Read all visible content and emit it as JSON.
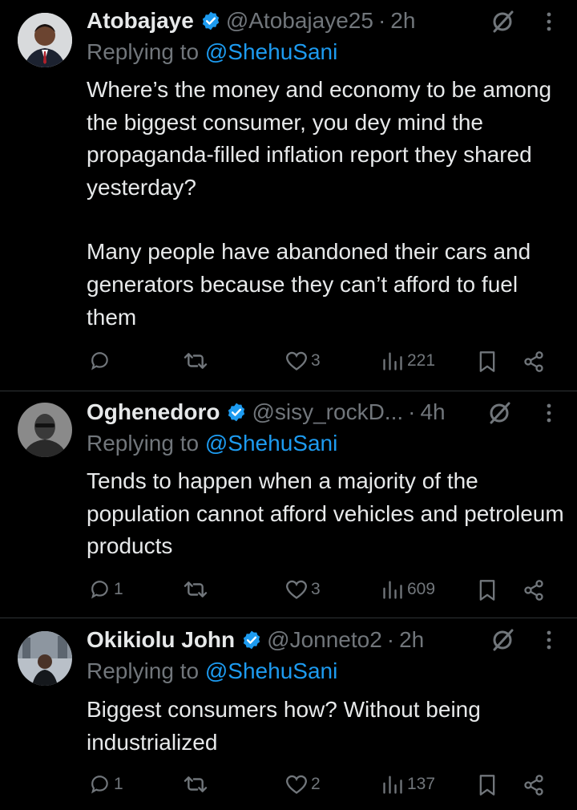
{
  "tweets": [
    {
      "name": "Atobajaye",
      "handle": "@Atobajaye25",
      "time": "2h",
      "replying_prefix": "Replying to ",
      "replying_to": "@ShehuSani",
      "paragraphs": [
        "Where’s the money and economy to be among the biggest consumer, you dey mind the propaganda-filled inflation report they shared yesterday?",
        "Many people have abandoned their cars and generators because they can’t afford to fuel them"
      ],
      "replies": "",
      "retweets": "",
      "likes": "3",
      "views": "221"
    },
    {
      "name": "Oghenedoro",
      "handle": "@sisy_rockD...",
      "time": "4h",
      "replying_prefix": "Replying to ",
      "replying_to": "@ShehuSani",
      "paragraphs": [
        "Tends to happen when a majority of the population cannot afford vehicles and petroleum products"
      ],
      "replies": "1",
      "retweets": "",
      "likes": "3",
      "views": "609"
    },
    {
      "name": "Okikiolu John",
      "handle": "@Jonneto2",
      "time": "2h",
      "replying_prefix": "Replying to ",
      "replying_to": "@ShehuSani",
      "paragraphs": [
        "Biggest consumers how? Without being industrialized"
      ],
      "replies": "1",
      "retweets": "",
      "likes": "2",
      "views": "137"
    }
  ],
  "colors": {
    "background": "#000000",
    "text": "#e7e9ea",
    "secondary": "#71767b",
    "accent": "#1d9bf0",
    "divider": "#2f3336"
  },
  "icons": [
    "verified-badge-icon",
    "grok-icon",
    "more-icon",
    "reply-icon",
    "retweet-icon",
    "like-icon",
    "views-icon",
    "bookmark-icon",
    "share-icon"
  ]
}
